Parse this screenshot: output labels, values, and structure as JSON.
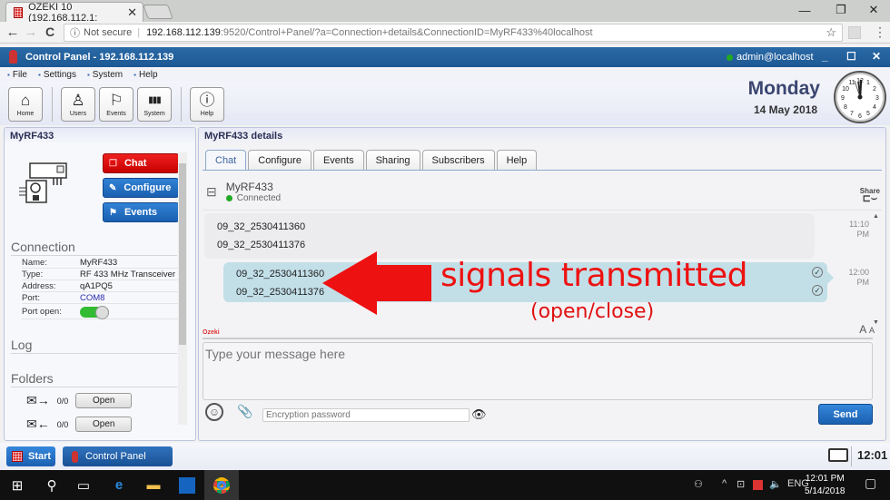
{
  "browser": {
    "tab_title": "OZEKI 10 (192.168.112.1:",
    "url_security": "Not secure",
    "url_host": "192.168.112.139",
    "url_path": ":9520/Control+Panel/?a=Connection+details&ConnectionID=MyRF433%40localhost",
    "icons": {
      "back": "←",
      "forward": "→",
      "reload": "C",
      "info": "ⓘ",
      "star": "☆",
      "menu": "⋮",
      "minimize": "—",
      "restore": "❐",
      "close": "✕"
    }
  },
  "app": {
    "title": "Control Panel - 192.168.112.139",
    "user": "admin@localhost",
    "menu": [
      "File",
      "Settings",
      "System",
      "Help"
    ],
    "toolbar": [
      {
        "label": "Home",
        "icon": "⌂"
      },
      {
        "label": "Users",
        "icon": "♙"
      },
      {
        "label": "Events",
        "icon": "⚐"
      },
      {
        "label": "System",
        "icon": "▮▮▮"
      },
      {
        "label": "Help",
        "icon": "ⓘ"
      }
    ],
    "day": "Monday",
    "date": "14 May 2018",
    "clock_time": "11:59"
  },
  "left_panel": {
    "title": "MyRF433",
    "buttons": {
      "chat": "Chat",
      "configure": "Configure",
      "events": "Events"
    },
    "connection_heading": "Connection",
    "fields": [
      {
        "key": "Name:",
        "value": "MyRF433"
      },
      {
        "key": "Type:",
        "value": "RF 433 MHz Transceiver"
      },
      {
        "key": "Address:",
        "value": "qA1PQ5"
      },
      {
        "key": "Port:",
        "value": "COM8"
      },
      {
        "key": "Port open:",
        "value": true
      }
    ],
    "log_heading": "Log",
    "folders_heading": "Folders",
    "folders": [
      {
        "count": "0/0",
        "button": "Open",
        "direction": "outbox"
      },
      {
        "count": "0/0",
        "button": "Open",
        "direction": "inbox"
      }
    ]
  },
  "right_panel": {
    "title": "MyRF433 details",
    "tabs": [
      "Chat",
      "Configure",
      "Events",
      "Sharing",
      "Subscribers",
      "Help"
    ],
    "active_tab": "Chat",
    "contact": {
      "name": "MyRF433",
      "status": "Connected"
    },
    "share_label": "Share",
    "messages": [
      {
        "direction": "incoming",
        "lines": [
          "09_32_2530411360",
          "09_32_2530411376"
        ],
        "time": "11:10 PM"
      },
      {
        "direction": "outgoing",
        "lines": [
          "09_32_2530411360",
          "09_32_2530411376"
        ],
        "time": "12:00 PM"
      }
    ],
    "annotation": {
      "main": "signals transmitted",
      "sub": "(open/close)",
      "color": "#ee1111"
    },
    "brand_label": "Ozeki",
    "font_size_controls": [
      "A",
      "A"
    ],
    "message_placeholder": "Type your message here",
    "encryption_placeholder": "Encryption password",
    "send_label": "Send"
  },
  "footer": {
    "start_label": "Start",
    "control_panel_label": "Control Panel",
    "time": "12:01"
  },
  "taskbar": {
    "time": "12:01 PM",
    "date": "5/14/2018",
    "lang": "ENG"
  }
}
